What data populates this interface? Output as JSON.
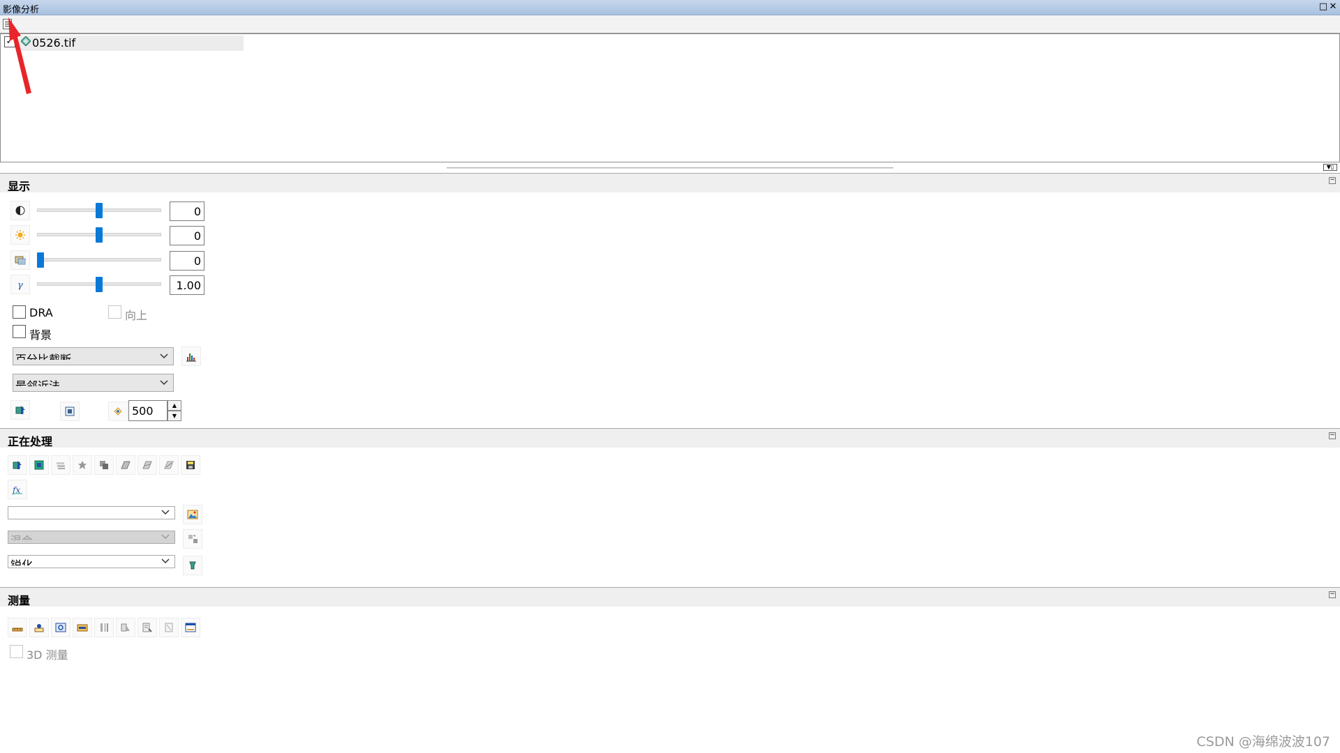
{
  "window": {
    "title": "影像分析",
    "maximize_glyph": "□",
    "close_glyph": "✕"
  },
  "layers": [
    {
      "name": "0526.tif",
      "checked": true,
      "check_glyph": "✓"
    }
  ],
  "splitter": {
    "pin_glyph": "▼▯"
  },
  "display": {
    "header": "显示",
    "sliders": [
      {
        "icon": "contrast-icon",
        "value": "0",
        "fraction": 0.5
      },
      {
        "icon": "brightness-icon",
        "value": "0",
        "fraction": 0.5
      },
      {
        "icon": "transparency-icon",
        "value": "0",
        "fraction": 0.0
      },
      {
        "icon": "gamma-icon",
        "value": "1.00",
        "fraction": 0.5
      }
    ],
    "dra_label": "DRA",
    "up_label": "向上",
    "background_label": "背景",
    "stretch_value": "百分比截断",
    "resample_value": "最邻近法",
    "swipe_value": "500"
  },
  "processing": {
    "header": "正在处理",
    "combo1_value": "",
    "combo2_value": "混合",
    "combo3_value": "锐化",
    "tool_icons": [
      "clip-icon",
      "mask-icon",
      "composite-bands-icon",
      "ndvi-icon",
      "mosaic-icon",
      "differencing-icon",
      "shaded-relief-icon",
      "stretch-icon",
      "save-icon"
    ]
  },
  "measure": {
    "header": "测量",
    "tool_icons": [
      "distance-icon",
      "height-icon",
      "centroid-icon",
      "area-icon",
      "point-icon",
      "shadow-icon",
      "table-icon",
      "clear-icon",
      "window-icon"
    ],
    "measure3d_label": "3D 测量"
  },
  "watermark": "CSDN @海绵波波107",
  "colors": {
    "accent": "#0a78d7",
    "title_bar": "#b7cbe6",
    "arrow": "#e8252a"
  }
}
